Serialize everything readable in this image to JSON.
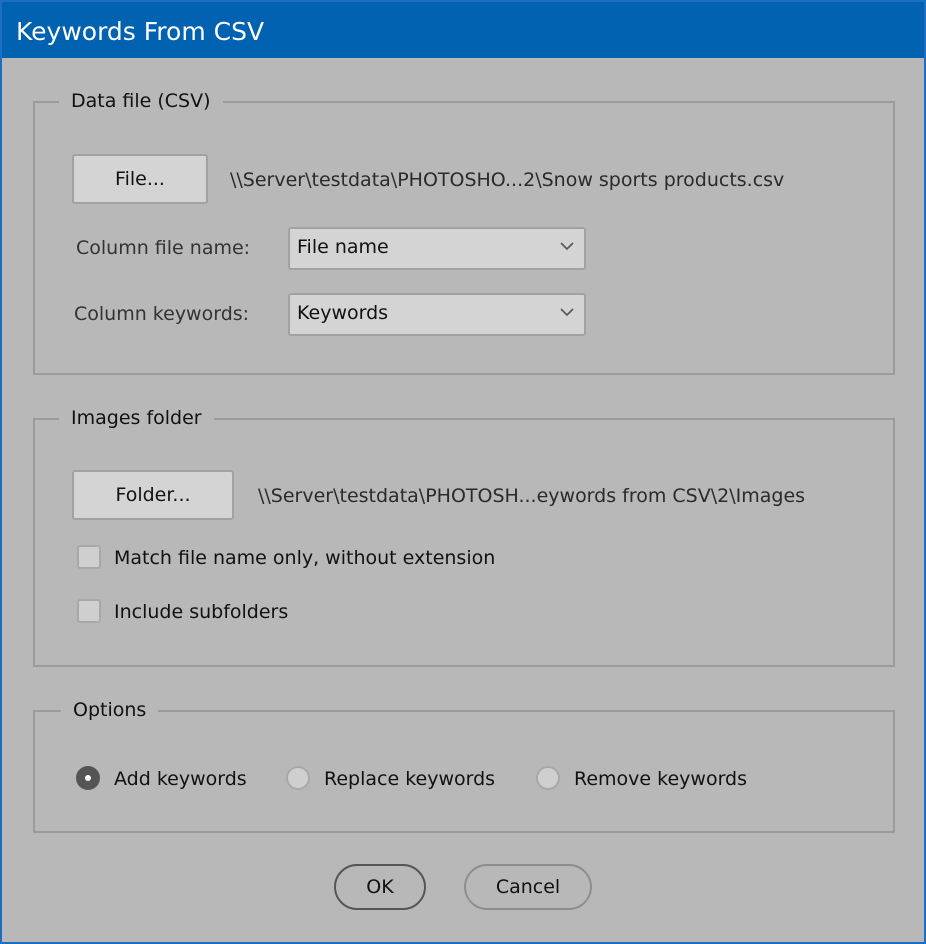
{
  "window": {
    "title": "Keywords From CSV"
  },
  "data_file": {
    "legend": "Data file (CSV)",
    "file_button": "File...",
    "file_path": "\\\\Server\\testdata\\PHOTOSHO...2\\Snow sports products.csv",
    "column_file_name_label": "Column file name:",
    "column_file_name_value": "File name",
    "column_keywords_label": "Column keywords:",
    "column_keywords_value": "Keywords"
  },
  "images_folder": {
    "legend": "Images folder",
    "folder_button": "Folder...",
    "folder_path": "\\\\Server\\testdata\\PHOTOSH...eywords from CSV\\2\\Images",
    "match_label": "Match file name only, without extension",
    "match_checked": false,
    "subfolders_label": "Include subfolders",
    "subfolders_checked": false
  },
  "options": {
    "legend": "Options",
    "radios": [
      {
        "label": "Add keywords",
        "selected": true
      },
      {
        "label": "Replace keywords",
        "selected": false
      },
      {
        "label": "Remove keywords",
        "selected": false
      }
    ]
  },
  "buttons": {
    "ok": "OK",
    "cancel": "Cancel"
  }
}
